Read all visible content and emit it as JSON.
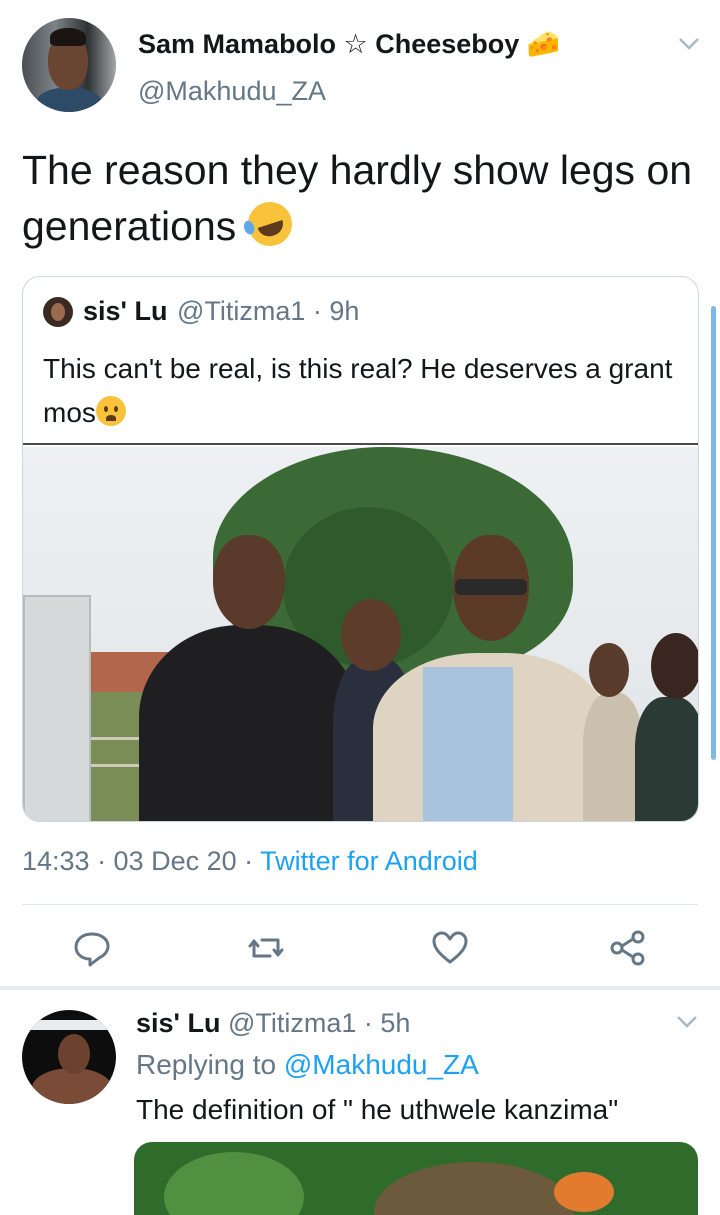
{
  "tweet": {
    "display_name": "Sam Mamabolo ☆ Cheeseboy 🧀",
    "handle": "@Makhudu_ZA",
    "text": "The reason they hardly show legs on generations",
    "emoji_icon": "rolling-on-floor-laughing-emoji"
  },
  "quoted": {
    "name": "sis' Lu",
    "meta": "@Titizma1 · 9h",
    "text": "This can't be real, is this real? He deserves a grant mos",
    "emoji_icon": "worried-face-emoji"
  },
  "details": {
    "timestamp": "14:33 · 03 Dec 20 · ",
    "source": "Twitter for Android"
  },
  "actions": {
    "reply_icon": "reply-icon",
    "retweet_icon": "retweet-icon",
    "like_icon": "heart-icon",
    "share_icon": "share-icon"
  },
  "reply": {
    "name": "sis' Lu",
    "meta": "@Titizma1 · 5h",
    "replying_prefix": "Replying to ",
    "replying_mention": "@Makhudu_ZA",
    "text": "The definition of \" he uthwele kanzima\""
  },
  "colors": {
    "accent": "#1da1f2",
    "secondary_text": "#657786",
    "border": "#ccd6dd"
  }
}
